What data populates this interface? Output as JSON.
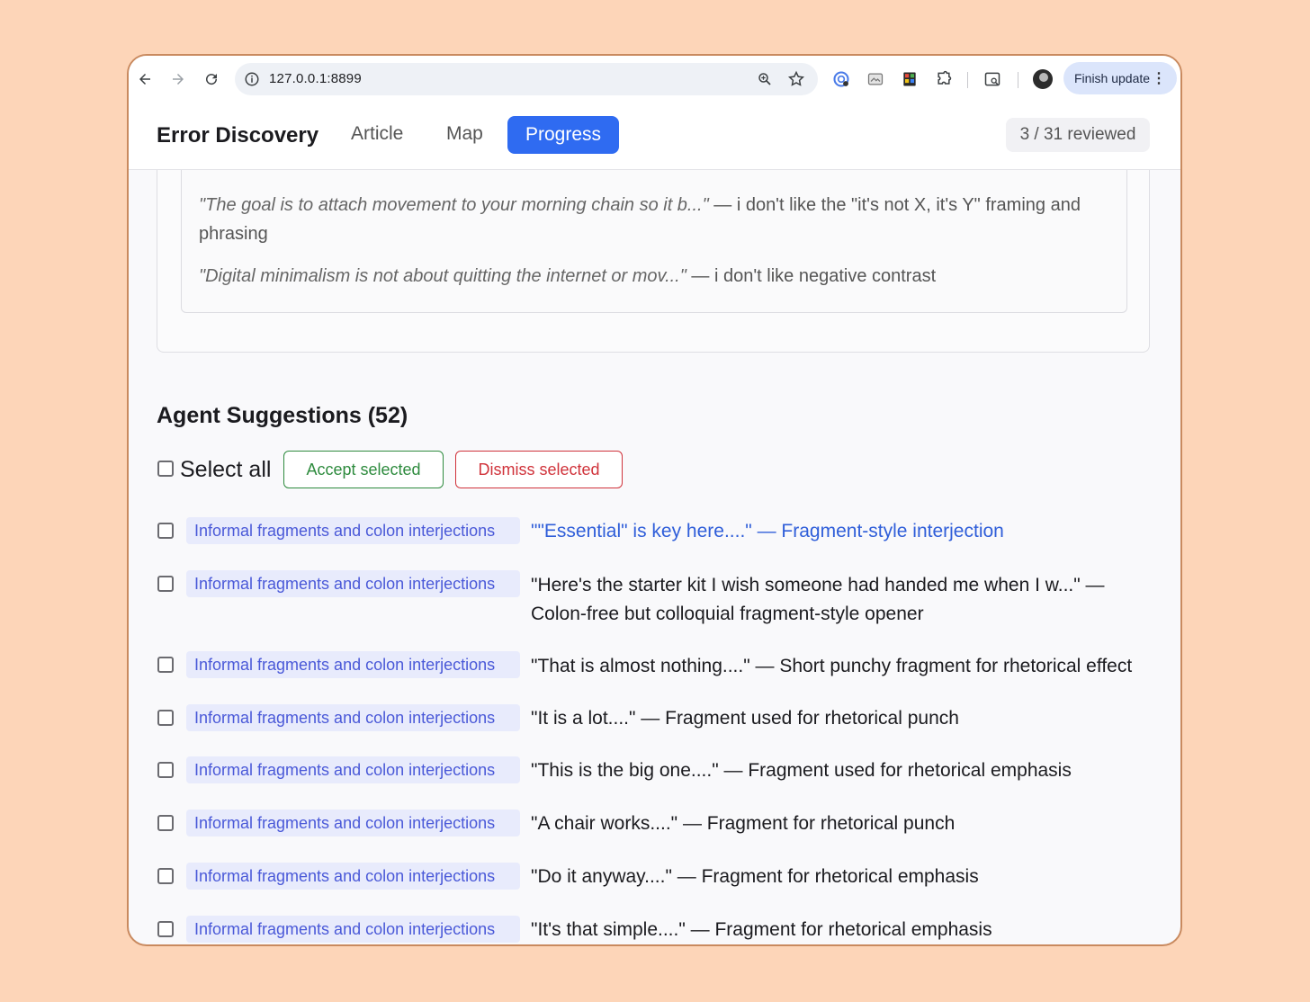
{
  "browser": {
    "url": "127.0.0.1:8899",
    "finish_update_label": "Finish update"
  },
  "app": {
    "title": "Error Discovery",
    "tabs": [
      "Article",
      "Map",
      "Progress"
    ],
    "active_tab": "Progress",
    "reviewed_badge": "3 / 31 reviewed"
  },
  "feedback": [
    {
      "quote": "\"The goal is to attach movement to your morning chain so it b...\"",
      "comment": " — i don't like the \"it's not X, it's Y\" framing and phrasing"
    },
    {
      "quote": "\"Digital minimalism is not about quitting the internet or mov...\"",
      "comment": " — i don't like negative contrast"
    }
  ],
  "suggestions": {
    "title": "Agent Suggestions (52)",
    "select_all_label": "Select all",
    "accept_label": "Accept selected",
    "dismiss_label": "Dismiss selected",
    "rows": [
      {
        "tag": "Informal fragments and colon interjections",
        "text": "\"\"Essential\" is key here....\" — Fragment-style interjection"
      },
      {
        "tag": "Informal fragments and colon interjections",
        "text": "\"Here's the starter kit I wish someone had handed me when I w...\" — Colon-free but colloquial fragment-style opener"
      },
      {
        "tag": "Informal fragments and colon interjections",
        "text": "\"That is almost nothing....\" — Short punchy fragment for rhetorical effect"
      },
      {
        "tag": "Informal fragments and colon interjections",
        "text": "\"It is a lot....\" — Fragment used for rhetorical punch"
      },
      {
        "tag": "Informal fragments and colon interjections",
        "text": "\"This is the big one....\" — Fragment used for rhetorical emphasis"
      },
      {
        "tag": "Informal fragments and colon interjections",
        "text": "\"A chair works....\" — Fragment for rhetorical punch"
      },
      {
        "tag": "Informal fragments and colon interjections",
        "text": "\"Do it anyway....\" — Fragment for rhetorical emphasis"
      },
      {
        "tag": "Informal fragments and colon interjections",
        "text": "\"It's that simple....\" — Fragment for rhetorical emphasis"
      }
    ]
  },
  "colors": {
    "accent": "#2f6bf1",
    "accept": "#2e8b3e",
    "dismiss": "#d0333b",
    "tag_bg": "#e8ebfc",
    "tag_text": "#4a59d8"
  }
}
